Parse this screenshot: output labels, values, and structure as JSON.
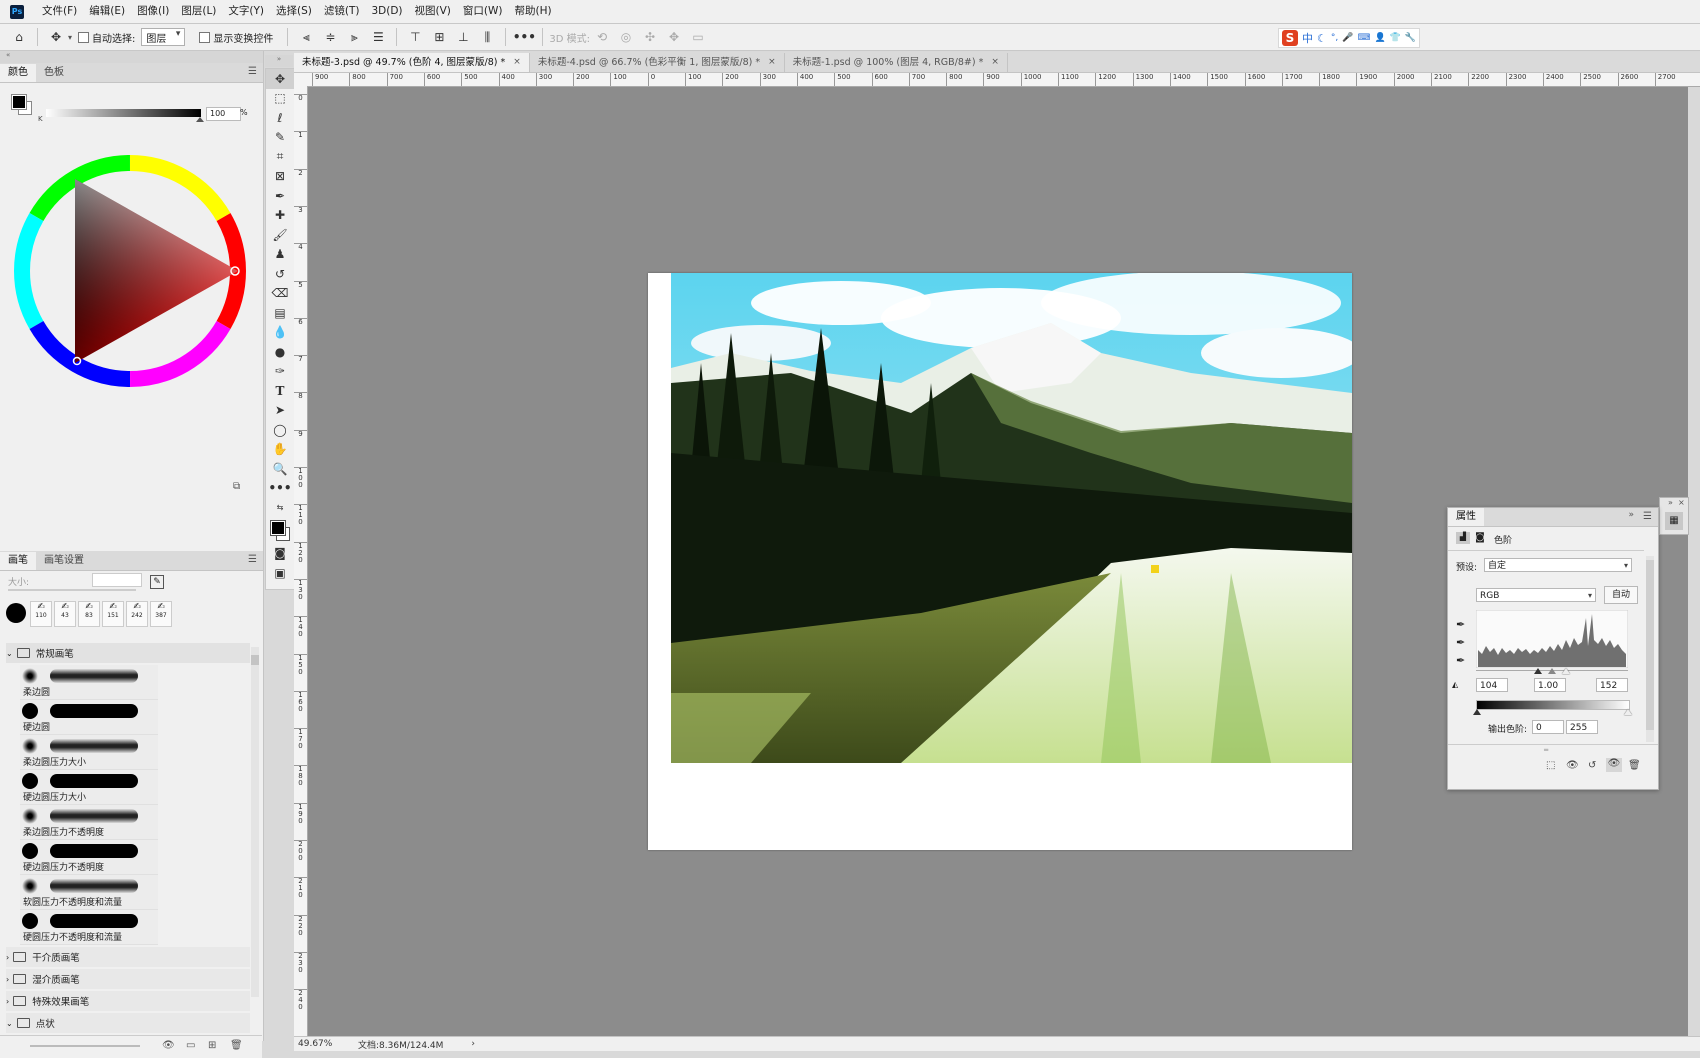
{
  "menubar": {
    "logo": "Ps",
    "items": [
      "文件(F)",
      "编辑(E)",
      "图像(I)",
      "图层(L)",
      "文字(Y)",
      "选择(S)",
      "滤镜(T)",
      "3D(D)",
      "视图(V)",
      "窗口(W)",
      "帮助(H)"
    ]
  },
  "optionsbar": {
    "auto_select_label": "自动选择:",
    "auto_select_value": "图层",
    "show_transform_label": "显示变换控件",
    "mode_3d_label": "3D 模式:",
    "more": "•••",
    "ime": [
      "中",
      "☾",
      "°,",
      "🎤",
      "⌨",
      "👤",
      "👕",
      "🔧"
    ]
  },
  "doc_tabs": [
    {
      "label": "未标题-3.psd @ 49.7% (色阶 4, 图层蒙版/8) *",
      "active": true
    },
    {
      "label": "未标题-4.psd @ 66.7% (色彩平衡 1, 图层蒙版/8) *",
      "active": false
    },
    {
      "label": "未标题-1.psd @ 100% (图层 4, RGB/8#) *",
      "active": false
    }
  ],
  "hruler_ticks": [
    "900",
    "800",
    "700",
    "600",
    "500",
    "400",
    "300",
    "200",
    "100",
    "0",
    "100",
    "200",
    "300",
    "400",
    "500",
    "600",
    "700",
    "800",
    "900",
    "1000",
    "1100",
    "1200",
    "1300",
    "1400",
    "1500",
    "1600",
    "1700",
    "1800",
    "1900",
    "2000",
    "2100",
    "2200",
    "2300",
    "2400",
    "2500",
    "2600",
    "2700"
  ],
  "vruler_ticks": [
    "0",
    "1",
    "2",
    "3",
    "4",
    "5",
    "6",
    "7",
    "8",
    "9",
    "1\n0\n0",
    "1\n1\n0",
    "1\n2\n0",
    "1\n3\n0",
    "1\n4\n0",
    "1\n5\n0",
    "1\n6\n0",
    "1\n7\n0",
    "1\n8\n0",
    "1\n9\n0",
    "2\n0\n0",
    "2\n1\n0",
    "2\n2\n0",
    "2\n3\n0",
    "2\n4\n0"
  ],
  "color_panel": {
    "tabs": [
      "颜色",
      "色板"
    ],
    "channel_label": "K",
    "value": "100",
    "unit": "%"
  },
  "brush_panel": {
    "tabs": [
      "画笔",
      "画笔设置"
    ],
    "size_label": "大小:",
    "presets": [
      "110",
      "43",
      "83",
      "151",
      "242",
      "387"
    ],
    "group_open": "常规画笔",
    "brushes": [
      "柔边圆",
      "硬边圆",
      "柔边圆压力大小",
      "硬边圆压力大小",
      "柔边圆压力不透明度",
      "硬边圆压力不透明度",
      "软圆压力不透明度和流量",
      "硬圆压力不透明度和流量"
    ],
    "groups_closed": [
      "干介质画笔",
      "湿介质画笔",
      "特殊效果画笔"
    ],
    "group_last": "点状"
  },
  "properties": {
    "tab": "属性",
    "type_label": "色阶",
    "preset_label": "预设:",
    "preset_value": "自定",
    "channel_value": "RGB",
    "auto_label": "自动",
    "input_black": "104",
    "input_gamma": "1.00",
    "input_white": "152",
    "output_label": "输出色阶:",
    "output_black": "0",
    "output_white": "255"
  },
  "status": {
    "zoom": "49.67%",
    "doc_size": "文档:8.36M/124.4M",
    "arrow": "›"
  },
  "colors": {
    "canvas_bg": "#8c8c8c",
    "panel_bg": "#f0f0f0",
    "accent_ime": "#e04020"
  }
}
